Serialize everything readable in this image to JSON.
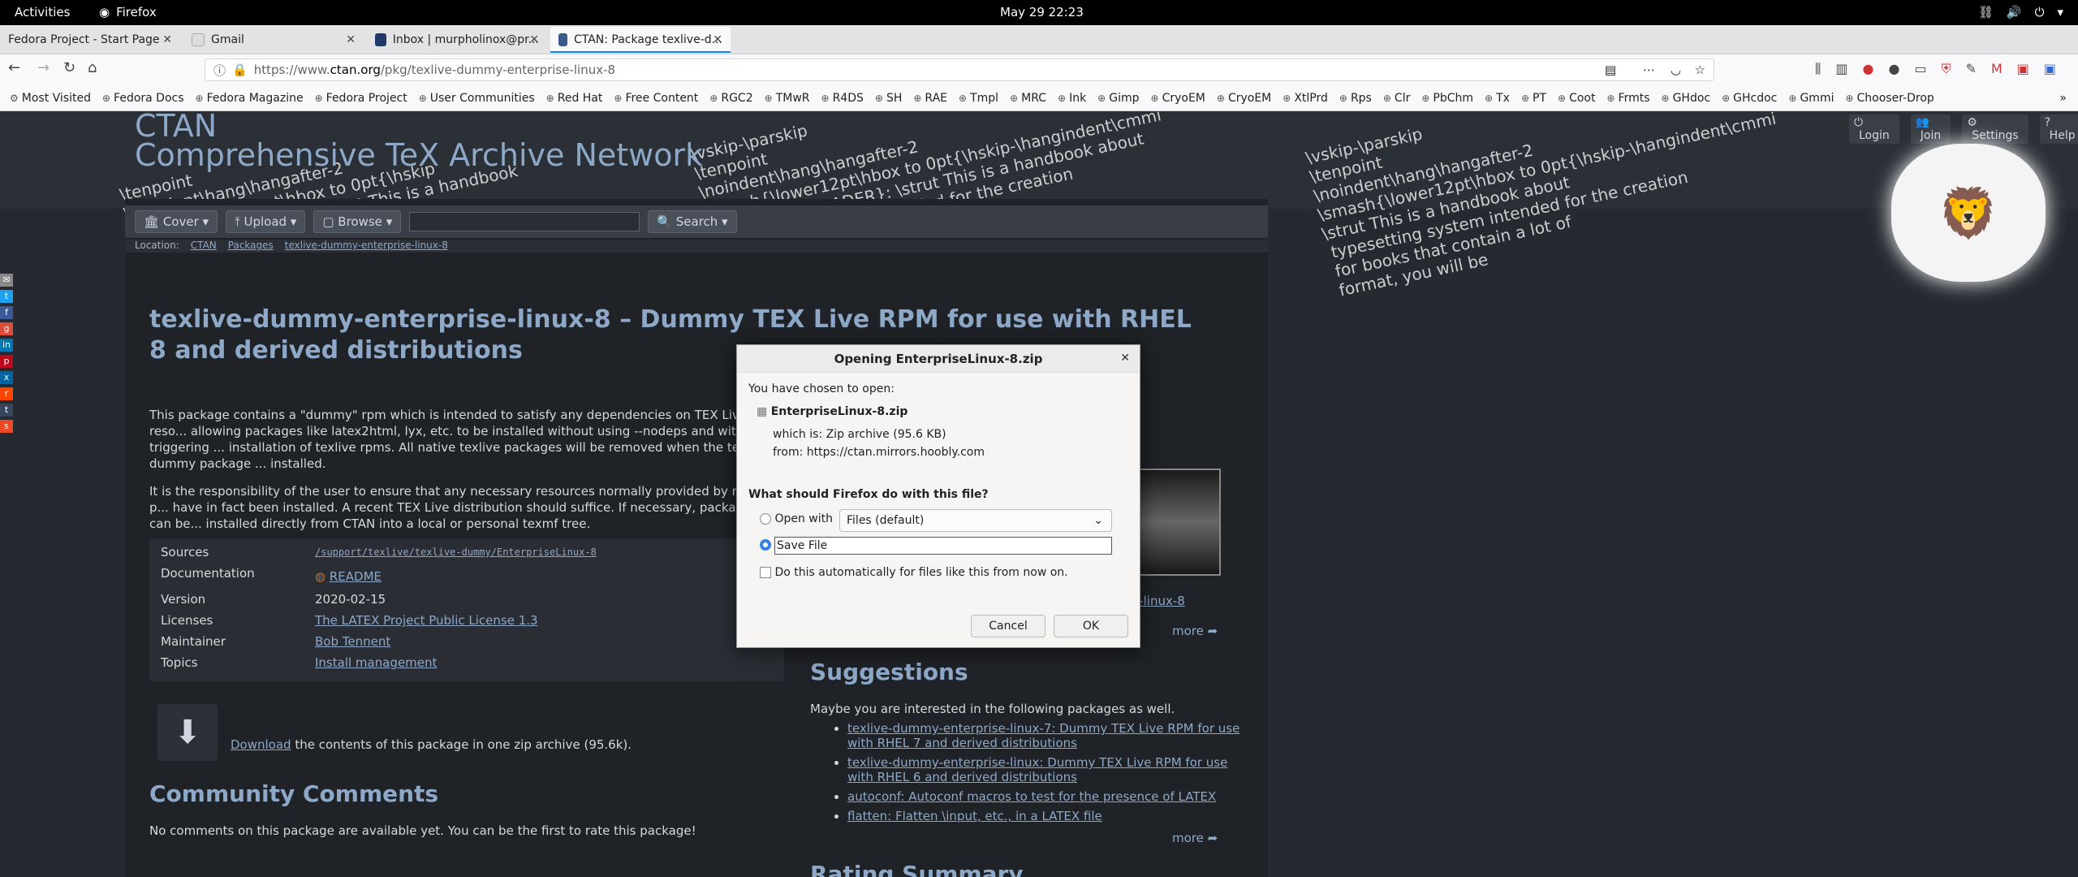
{
  "gnome": {
    "activities": "Activities",
    "app": "Firefox",
    "clock": "May 29  22:23"
  },
  "tabs": [
    {
      "title": "Fedora Project - Start Page"
    },
    {
      "title": "Gmail"
    },
    {
      "title": "Inbox | murpholinox@pr..."
    },
    {
      "title": "CTAN: Package texlive-d..."
    }
  ],
  "url": {
    "prefix": "https://www.",
    "host": "ctan.org",
    "path": "/pkg/texlive-dummy-enterprise-linux-8"
  },
  "bookmarks": [
    "Most Visited",
    "Fedora Docs",
    "Fedora Magazine",
    "Fedora Project",
    "User Communities",
    "Red Hat",
    "Free Content",
    "RGC2",
    "TMwR",
    "R4DS",
    "SH",
    "RAE",
    "Tmpl",
    "MRC",
    "Ink",
    "Gimp",
    "CryoEM",
    "CryoEM",
    "XtlPrd",
    "Rps",
    "Clr",
    "PbChm",
    "Tx",
    "PT",
    "Coot",
    "Frmts",
    "GHdoc",
    "GHcdoc",
    "Gmmi",
    "Chooser-Drop"
  ],
  "site": {
    "title_line1": "CTAN",
    "title_line2": "Comprehensive TeX Archive Network",
    "login": "Login",
    "join": "Join",
    "settings": "Settings",
    "help": "Help",
    "menu": {
      "cover": "Cover",
      "upload": "Upload",
      "browse": "Browse",
      "search": "Search"
    },
    "location": {
      "label": "Location:",
      "ctan": "CTAN",
      "packages": "Packages",
      "pkg": "texlive-dummy-enterprise-linux-8"
    }
  },
  "package": {
    "heading": "texlive-dummy-enterprise-linux-8 – Dummy TEX Live RPM for use with RHEL 8 and derived distributions",
    "p1": "This package contains a \"dummy\" rpm which is intended to satisfy any dependencies on TEX Live reso... allowing packages like latex2html, lyx, etc. to be installed without using --nodeps and without triggering ... installation of texlive rpms. All native texlive packages will be removed when the texlive-dummy package ... installed.",
    "p2": "It is the responsibility of the user to ensure that any necessary resources normally provided by native p... have in fact been installed. A recent TEX Live distribution should suffice. If necessary, packages can be... installed directly from CTAN into a local or personal texmf tree.",
    "info": {
      "sources_label": "Sources",
      "sources_value": "/support/texlive/texlive-dummy/EnterpriseLinux-8",
      "doc_label": "Documentation",
      "doc_value": "README",
      "version_label": "Version",
      "version_value": "2020-02-15",
      "licenses_label": "Licenses",
      "licenses_value": "The LATEX Project Public License 1.3",
      "maintainer_label": "Maintainer",
      "maintainer_value": "Bob Tennent",
      "topics_label": "Topics",
      "topics_value": "Install management"
    },
    "download_link": "Download",
    "download_text": " the contents of this package in one zip archive (95.6k).",
    "community_heading": "Community Comments",
    "community_text": "No comments on this package are available yet. You can be the first to rate this package!",
    "right_link": "e-linux-8",
    "more1": "more ➦",
    "suggestions_heading": "Suggestions",
    "suggestions_intro": "Maybe you are interested in the following packages as well.",
    "suggestions": [
      "texlive-dummy-enterprise-linux-7: Dummy TEX Live RPM for use with RHEL 7 and derived distributions",
      "texlive-dummy-enterprise-linux: Dummy TEX Live RPM for use with RHEL 6 and derived distributions",
      "autoconf: Autoconf macros to test for the presence of LATEX",
      "flatten: Flatten \\input, etc., in a LATEX file"
    ],
    "more2": "more ➦",
    "rating_heading": "Rating Summary"
  },
  "dialog": {
    "title": "Opening EnterpriseLinux-8.zip",
    "chosen": "You have chosen to open:",
    "filename": "EnterpriseLinux-8.zip",
    "which_is": "which is:  Zip archive (95.6 KB)",
    "from": "from:  https://ctan.mirrors.hoobly.com",
    "question": "What should Firefox do with this file?",
    "open_with": "Open with",
    "app": "Files (default)",
    "save_file": "Save File",
    "auto": "Do this automatically for files like this from now on.",
    "cancel": "Cancel",
    "ok": "OK"
  }
}
